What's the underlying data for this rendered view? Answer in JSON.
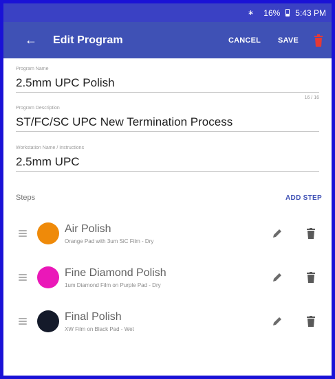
{
  "status_bar": {
    "bluetooth_icon": "bluetooth-icon",
    "battery_text": "16%",
    "battery_icon": "battery-icon",
    "time": "5:43 PM"
  },
  "app_bar": {
    "back_icon": "arrow-back-icon",
    "title": "Edit Program",
    "cancel_label": "CANCEL",
    "save_label": "SAVE",
    "delete_icon": "trash-icon",
    "background_color": "#3f51b5",
    "delete_color": "#e53935"
  },
  "form": {
    "program_name": {
      "label": "Program Name",
      "value": "2.5mm UPC Polish",
      "counter": "16 / 16"
    },
    "program_description": {
      "label": "Program Description",
      "value": "ST/FC/SC UPC New Termination Process"
    },
    "workstation_name": {
      "label": "Workstation Name / Instructions",
      "value": "2.5mm UPC"
    }
  },
  "steps_section": {
    "title": "Steps",
    "add_label": "ADD STEP",
    "accent_color": "#3f51b5"
  },
  "steps": [
    {
      "name": "Air Polish",
      "description": "Orange Pad with 3um SiC Film - Dry",
      "color": "#ef8a09"
    },
    {
      "name": "Fine Diamond Polish",
      "description": "1um Diamond Film on Purple Pad - Dry",
      "color": "#ea18b8"
    },
    {
      "name": "Final Polish",
      "description": "XW Film on Black Pad - Wet",
      "color": "#141a2a"
    }
  ]
}
